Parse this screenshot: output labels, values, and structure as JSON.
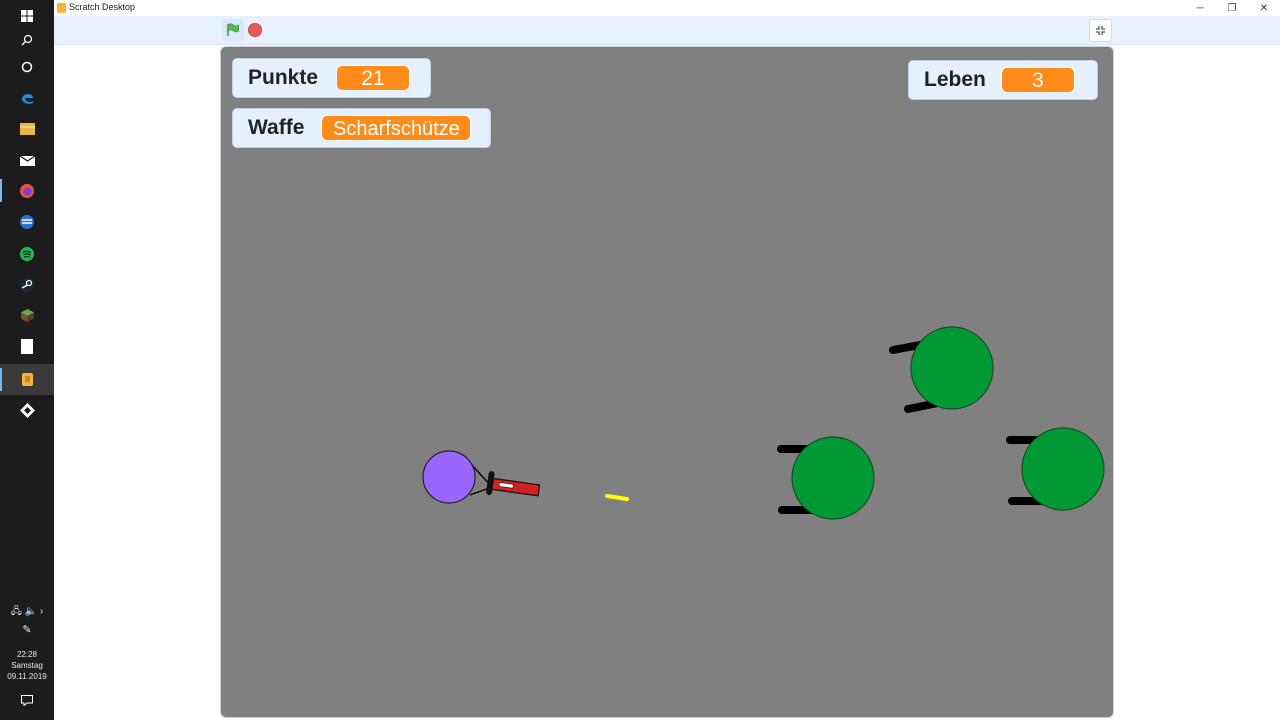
{
  "window": {
    "title": "Scratch Desktop",
    "controls": {
      "minimize": "─",
      "restore": "❐",
      "close": "✕"
    }
  },
  "taskbar": {
    "apps": [
      "windows-start-icon",
      "search-icon",
      "cortana-icon",
      "edge-icon",
      "file-explorer-icon",
      "mail-icon",
      "firefox-icon",
      "opera-icon",
      "spotify-icon",
      "steam-icon",
      "minecraft-icon",
      "notepad-icon",
      "scratch-icon",
      "gitkraken-icon"
    ],
    "clock": {
      "time": "22:28",
      "day": "Samstag",
      "date": "09.11.2019"
    }
  },
  "monitors": {
    "score": {
      "label": "Punkte",
      "value": "21"
    },
    "weapon": {
      "label": "Waffe",
      "value": "Scharfschütze"
    },
    "lives": {
      "label": "Leben",
      "value": "3"
    }
  },
  "colors": {
    "stage_background": "#808080",
    "monitor_value": "#ff8c1a",
    "player": "#9966ff",
    "enemy": "#009933",
    "bullet": "#ffff00"
  }
}
